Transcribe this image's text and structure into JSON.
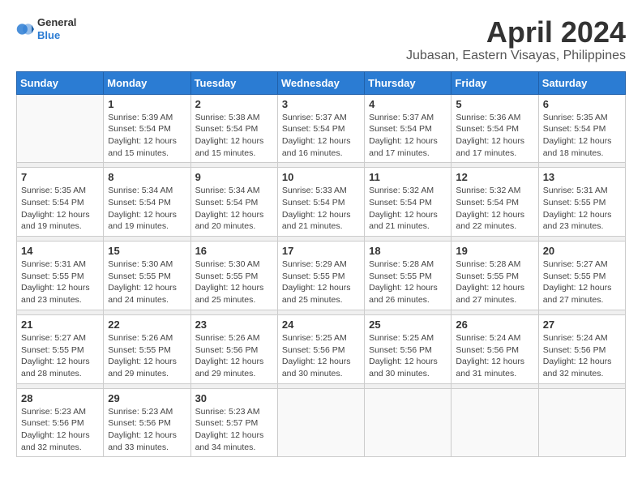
{
  "header": {
    "logo_line1": "General",
    "logo_line2": "Blue",
    "month_title": "April 2024",
    "location": "Jubasan, Eastern Visayas, Philippines"
  },
  "weekdays": [
    "Sunday",
    "Monday",
    "Tuesday",
    "Wednesday",
    "Thursday",
    "Friday",
    "Saturday"
  ],
  "weeks": [
    [
      {
        "day": "",
        "sunrise": "",
        "sunset": "",
        "daylight": ""
      },
      {
        "day": "1",
        "sunrise": "5:39 AM",
        "sunset": "5:54 PM",
        "daylight": "12 hours and 15 minutes."
      },
      {
        "day": "2",
        "sunrise": "5:38 AM",
        "sunset": "5:54 PM",
        "daylight": "12 hours and 15 minutes."
      },
      {
        "day": "3",
        "sunrise": "5:37 AM",
        "sunset": "5:54 PM",
        "daylight": "12 hours and 16 minutes."
      },
      {
        "day": "4",
        "sunrise": "5:37 AM",
        "sunset": "5:54 PM",
        "daylight": "12 hours and 17 minutes."
      },
      {
        "day": "5",
        "sunrise": "5:36 AM",
        "sunset": "5:54 PM",
        "daylight": "12 hours and 17 minutes."
      },
      {
        "day": "6",
        "sunrise": "5:35 AM",
        "sunset": "5:54 PM",
        "daylight": "12 hours and 18 minutes."
      }
    ],
    [
      {
        "day": "7",
        "sunrise": "5:35 AM",
        "sunset": "5:54 PM",
        "daylight": "12 hours and 19 minutes."
      },
      {
        "day": "8",
        "sunrise": "5:34 AM",
        "sunset": "5:54 PM",
        "daylight": "12 hours and 19 minutes."
      },
      {
        "day": "9",
        "sunrise": "5:34 AM",
        "sunset": "5:54 PM",
        "daylight": "12 hours and 20 minutes."
      },
      {
        "day": "10",
        "sunrise": "5:33 AM",
        "sunset": "5:54 PM",
        "daylight": "12 hours and 21 minutes."
      },
      {
        "day": "11",
        "sunrise": "5:32 AM",
        "sunset": "5:54 PM",
        "daylight": "12 hours and 21 minutes."
      },
      {
        "day": "12",
        "sunrise": "5:32 AM",
        "sunset": "5:54 PM",
        "daylight": "12 hours and 22 minutes."
      },
      {
        "day": "13",
        "sunrise": "5:31 AM",
        "sunset": "5:55 PM",
        "daylight": "12 hours and 23 minutes."
      }
    ],
    [
      {
        "day": "14",
        "sunrise": "5:31 AM",
        "sunset": "5:55 PM",
        "daylight": "12 hours and 23 minutes."
      },
      {
        "day": "15",
        "sunrise": "5:30 AM",
        "sunset": "5:55 PM",
        "daylight": "12 hours and 24 minutes."
      },
      {
        "day": "16",
        "sunrise": "5:30 AM",
        "sunset": "5:55 PM",
        "daylight": "12 hours and 25 minutes."
      },
      {
        "day": "17",
        "sunrise": "5:29 AM",
        "sunset": "5:55 PM",
        "daylight": "12 hours and 25 minutes."
      },
      {
        "day": "18",
        "sunrise": "5:28 AM",
        "sunset": "5:55 PM",
        "daylight": "12 hours and 26 minutes."
      },
      {
        "day": "19",
        "sunrise": "5:28 AM",
        "sunset": "5:55 PM",
        "daylight": "12 hours and 27 minutes."
      },
      {
        "day": "20",
        "sunrise": "5:27 AM",
        "sunset": "5:55 PM",
        "daylight": "12 hours and 27 minutes."
      }
    ],
    [
      {
        "day": "21",
        "sunrise": "5:27 AM",
        "sunset": "5:55 PM",
        "daylight": "12 hours and 28 minutes."
      },
      {
        "day": "22",
        "sunrise": "5:26 AM",
        "sunset": "5:55 PM",
        "daylight": "12 hours and 29 minutes."
      },
      {
        "day": "23",
        "sunrise": "5:26 AM",
        "sunset": "5:56 PM",
        "daylight": "12 hours and 29 minutes."
      },
      {
        "day": "24",
        "sunrise": "5:25 AM",
        "sunset": "5:56 PM",
        "daylight": "12 hours and 30 minutes."
      },
      {
        "day": "25",
        "sunrise": "5:25 AM",
        "sunset": "5:56 PM",
        "daylight": "12 hours and 30 minutes."
      },
      {
        "day": "26",
        "sunrise": "5:24 AM",
        "sunset": "5:56 PM",
        "daylight": "12 hours and 31 minutes."
      },
      {
        "day": "27",
        "sunrise": "5:24 AM",
        "sunset": "5:56 PM",
        "daylight": "12 hours and 32 minutes."
      }
    ],
    [
      {
        "day": "28",
        "sunrise": "5:23 AM",
        "sunset": "5:56 PM",
        "daylight": "12 hours and 32 minutes."
      },
      {
        "day": "29",
        "sunrise": "5:23 AM",
        "sunset": "5:56 PM",
        "daylight": "12 hours and 33 minutes."
      },
      {
        "day": "30",
        "sunrise": "5:23 AM",
        "sunset": "5:57 PM",
        "daylight": "12 hours and 34 minutes."
      },
      {
        "day": "",
        "sunrise": "",
        "sunset": "",
        "daylight": ""
      },
      {
        "day": "",
        "sunrise": "",
        "sunset": "",
        "daylight": ""
      },
      {
        "day": "",
        "sunrise": "",
        "sunset": "",
        "daylight": ""
      },
      {
        "day": "",
        "sunrise": "",
        "sunset": "",
        "daylight": ""
      }
    ]
  ],
  "labels": {
    "sunrise_prefix": "Sunrise: ",
    "sunset_prefix": "Sunset: ",
    "daylight_prefix": "Daylight: "
  }
}
